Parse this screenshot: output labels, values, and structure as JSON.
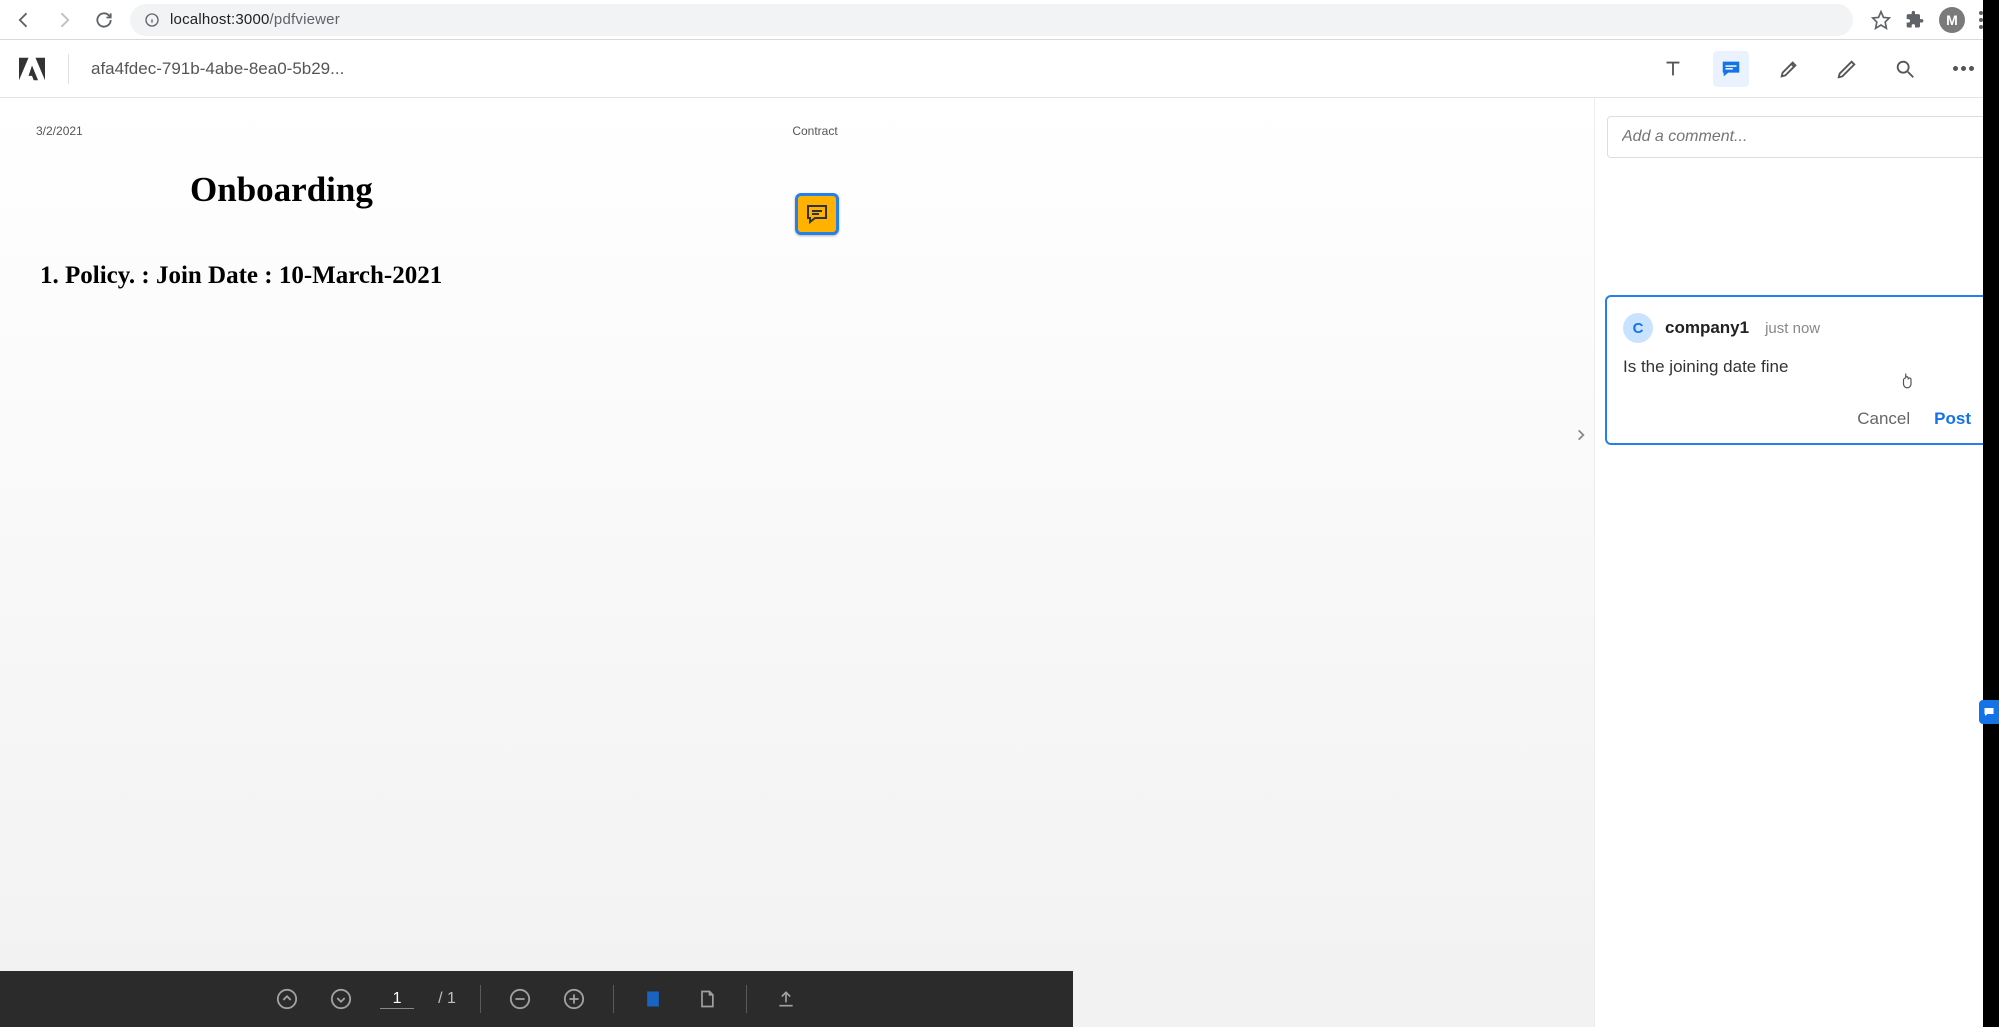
{
  "browser": {
    "url_host": "localhost:3000",
    "url_path": "/pdfviewer",
    "avatar_initial": "M"
  },
  "toolbar": {
    "file_name": "afa4fdec-791b-4abe-8ea0-5b29..."
  },
  "document": {
    "header_left": "3/2/2021",
    "header_center": "Contract",
    "title": "Onboarding",
    "line1": "1.  Policy. :   Join Date  : 10-March-2021"
  },
  "comments": {
    "add_placeholder": "Add a comment...",
    "card": {
      "avatar_initial": "C",
      "author": "company1",
      "timestamp": "just now",
      "body": "Is the joining date fine",
      "cancel_label": "Cancel",
      "post_label": "Post"
    }
  },
  "pager": {
    "current": "1",
    "total": "/ 1"
  }
}
